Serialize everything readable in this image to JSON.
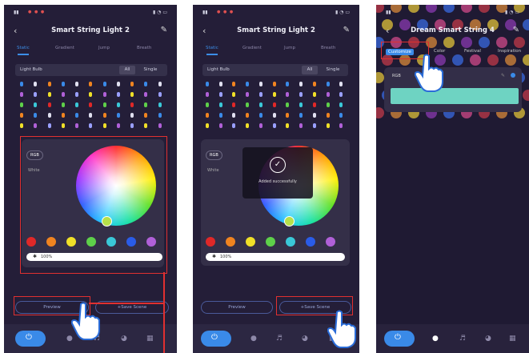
{
  "panel1": {
    "title": "Smart String Light 2",
    "tabs": [
      "Static",
      "Gradient",
      "Jump",
      "Breath"
    ],
    "light_bulb_label": "Light Bulb",
    "all_label": "All",
    "single_label": "Single",
    "rgb_label": "RGB",
    "white_label": "White",
    "brightness": "100%",
    "preview_label": "Preview",
    "save_scene_label": "+Save Scene"
  },
  "panel2": {
    "title": "Smart String Light 2",
    "tabs": [
      "Static",
      "Gradient",
      "Jump",
      "Breath"
    ],
    "light_bulb_label": "Light Bulb",
    "all_label": "All",
    "single_label": "Single",
    "rgb_label": "RGB",
    "white_label": "White",
    "brightness": "100%",
    "toast": "Added successfully",
    "preview_label": "Preview",
    "save_scene_label": "+Save Scene"
  },
  "panel3": {
    "title": "Dream Smart String 4",
    "tabs": [
      "Customize",
      "Color",
      "Festival",
      "Inspiration"
    ],
    "rgb_label": "RGB"
  },
  "swatch_colors": [
    "#e02828",
    "#f08420",
    "#f0e028",
    "#5ed04a",
    "#3ac8d8",
    "#2a5ce8",
    "#b060d8"
  ],
  "accent_color": "#3a8ae8",
  "card_color": "#6ed3c2",
  "icons": [
    "back-icon",
    "edit-icon",
    "power-icon",
    "bulb-icon",
    "music-icon",
    "palette-icon",
    "grid-icon",
    "pointer-hand-icon",
    "checkmark-icon",
    "sun-icon"
  ]
}
